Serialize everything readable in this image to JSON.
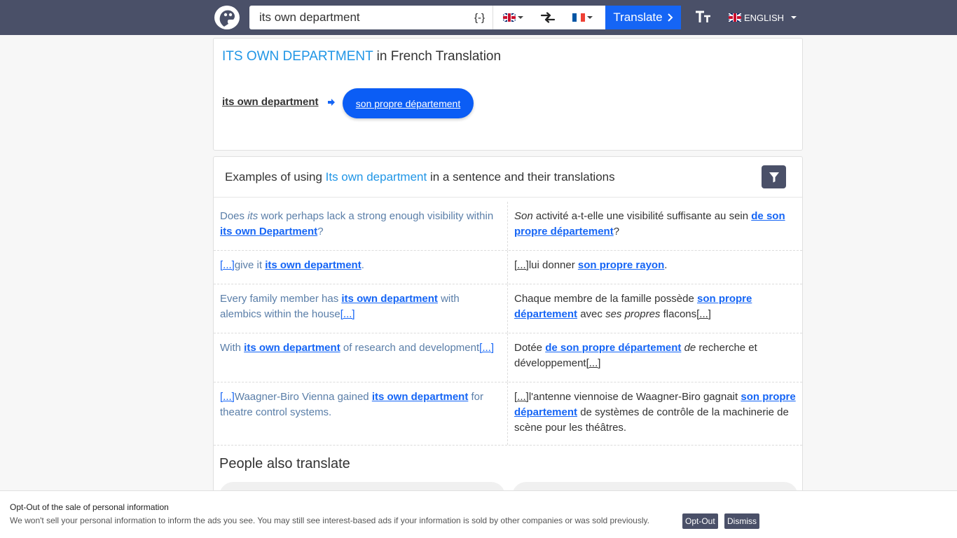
{
  "header": {
    "search_value": "its own department",
    "regex_label": "{-}",
    "translate_label": "Translate",
    "ui_language": "ENGLISH"
  },
  "result": {
    "title_term": "ITS OWN DEPARTMENT",
    "title_suffix": "in French Translation",
    "source_term": "its own department",
    "translation": "son propre département"
  },
  "examples": {
    "heading_prefix": "Examples of using",
    "heading_term": "Its own department",
    "heading_suffix": "in a sentence and their translations",
    "rows": [
      {
        "src": [
          [
            "t",
            "Does "
          ],
          [
            "i",
            "its"
          ],
          [
            "t",
            " work perhaps lack a strong enough visibility within "
          ],
          [
            "l",
            "its own Department"
          ],
          [
            "t",
            "?"
          ]
        ],
        "dst": [
          [
            "i",
            "Son"
          ],
          [
            "t",
            " activité a-t-elle une visibilité suffisante au sein "
          ],
          [
            "l",
            "de son propre département"
          ],
          [
            "t",
            "?"
          ]
        ],
        "height": 70
      },
      {
        "src": [
          [
            "e",
            "[...]"
          ],
          [
            "t",
            "give it "
          ],
          [
            "l",
            "its own department"
          ],
          [
            "t",
            "."
          ]
        ],
        "dst": [
          [
            "e",
            "[...]"
          ],
          [
            "t",
            "lui donner "
          ],
          [
            "l",
            "son propre rayon"
          ],
          [
            "t",
            "."
          ]
        ],
        "height": 48
      },
      {
        "src": [
          [
            "t",
            "Every family member has "
          ],
          [
            "l",
            "its own department"
          ],
          [
            "t",
            " with alembics within the house"
          ],
          [
            "e",
            "[...]"
          ]
        ],
        "dst": [
          [
            "t",
            "Chaque membre de la famille possède "
          ],
          [
            "l",
            "son propre département"
          ],
          [
            "t",
            " avec "
          ],
          [
            "i",
            "ses propres"
          ],
          [
            "t",
            " flacons"
          ],
          [
            "e",
            "[...]"
          ]
        ],
        "height": 70
      },
      {
        "src": [
          [
            "t",
            "With "
          ],
          [
            "l",
            "its own department"
          ],
          [
            "t",
            " of research and development"
          ],
          [
            "e",
            "[...]"
          ]
        ],
        "dst": [
          [
            "t",
            "Dotée "
          ],
          [
            "l",
            "de son propre département"
          ],
          [
            "t",
            " "
          ],
          [
            "i",
            "de"
          ],
          [
            "t",
            " recherche et développement"
          ],
          [
            "e",
            "[...]"
          ]
        ],
        "height": 70
      },
      {
        "src": [
          [
            "e",
            "[...]"
          ],
          [
            "t",
            "Waagner-Biro Vienna gained "
          ],
          [
            "l",
            "its own department"
          ],
          [
            "t",
            " for theatre control systems."
          ]
        ],
        "dst": [
          [
            "e",
            "[...]"
          ],
          [
            "t",
            "l'antenne viennoise de Waagner-Biro gagnait "
          ],
          [
            "l",
            "son propre département"
          ],
          [
            "t",
            " de systèmes de contrôle de la machinerie de scène pour les théâtres."
          ]
        ],
        "height": 90
      }
    ]
  },
  "people_also_translate": {
    "heading": "People also translate"
  },
  "consent": {
    "title": "Opt-Out of the sale of personal information",
    "text": "We won't sell your personal information to inform the ads you see. You may still see interest-based ads if your information is sold by other companies or was sold previously.",
    "optout_label": "Opt-Out",
    "dismiss_label": "Dismiss"
  },
  "colors": {
    "header_bg": "#4a5068",
    "accent_blue": "#1565f5",
    "highlight_blue": "#2196e6"
  },
  "icons": {
    "logo": "parrot-logo-icon",
    "swap": "swap-arrows-icon",
    "filter": "filter-funnel-icon",
    "font_size": "text-size-icon",
    "arrow": "right-arrow-icon"
  }
}
